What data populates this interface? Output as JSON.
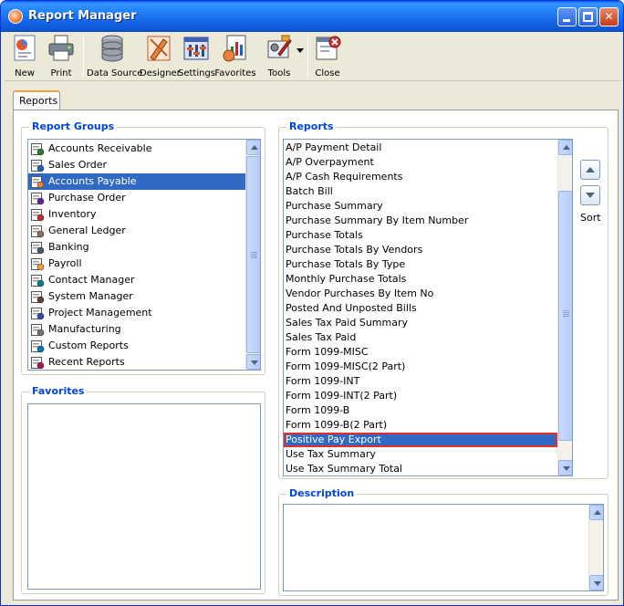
{
  "window": {
    "title": "Report Manager"
  },
  "toolbar": {
    "new_label": "New",
    "print_label": "Print",
    "data_source_label": "Data Source",
    "designer_label": "Designer",
    "settings_label": "Settings",
    "favorites_label": "Favorites",
    "tools_label": "Tools",
    "close_label": "Close"
  },
  "tabs": [
    {
      "label": "Reports",
      "active": true
    }
  ],
  "report_groups": {
    "title": "Report Groups",
    "items": [
      {
        "label": "Accounts Receivable",
        "icon": "receivable-icon"
      },
      {
        "label": "Sales Order",
        "icon": "sales-order-icon"
      },
      {
        "label": "Accounts Payable",
        "icon": "payable-icon",
        "selected": true
      },
      {
        "label": "Purchase Order",
        "icon": "purchase-order-icon"
      },
      {
        "label": "Inventory",
        "icon": "inventory-icon"
      },
      {
        "label": "General Ledger",
        "icon": "ledger-icon"
      },
      {
        "label": "Banking",
        "icon": "bank-icon"
      },
      {
        "label": "Payroll",
        "icon": "payroll-icon"
      },
      {
        "label": "Contact Manager",
        "icon": "contact-icon"
      },
      {
        "label": "System Manager",
        "icon": "system-icon"
      },
      {
        "label": "Project Management",
        "icon": "project-icon"
      },
      {
        "label": "Manufacturing",
        "icon": "gear-icon"
      },
      {
        "label": "Custom Reports",
        "icon": "custom-report-icon"
      },
      {
        "label": "Recent Reports",
        "icon": "recent-report-icon"
      }
    ]
  },
  "favorites": {
    "title": "Favorites"
  },
  "reports": {
    "title": "Reports",
    "items": [
      "A/P Payment Detail",
      "A/P Overpayment",
      "A/P Cash Requirements",
      "Batch Bill",
      "Purchase Summary",
      "Purchase Summary By Item Number",
      "Purchase Totals",
      "Purchase Totals By Vendors",
      "Purchase Totals By Type",
      "Monthly Purchase Totals",
      "Vendor Purchases By Item No",
      "Posted And Unposted Bills",
      "Sales Tax Paid Summary",
      "Sales Tax Paid",
      "Form 1099-MISC",
      "Form 1099-MISC(2 Part)",
      "Form 1099-INT",
      "Form 1099-INT(2 Part)",
      "Form 1099-B",
      "Form 1099-B(2 Part)",
      "Positive Pay Export",
      "Use Tax Summary",
      "Use Tax Summary Total"
    ],
    "selected_index": 20
  },
  "sort": {
    "label": "Sort"
  },
  "description": {
    "title": "Description"
  },
  "colors": {
    "title_bar": "#1F78F3",
    "selection": "#316AC5",
    "group_title": "#0046D5",
    "highlight_outline": "#E0302A"
  }
}
